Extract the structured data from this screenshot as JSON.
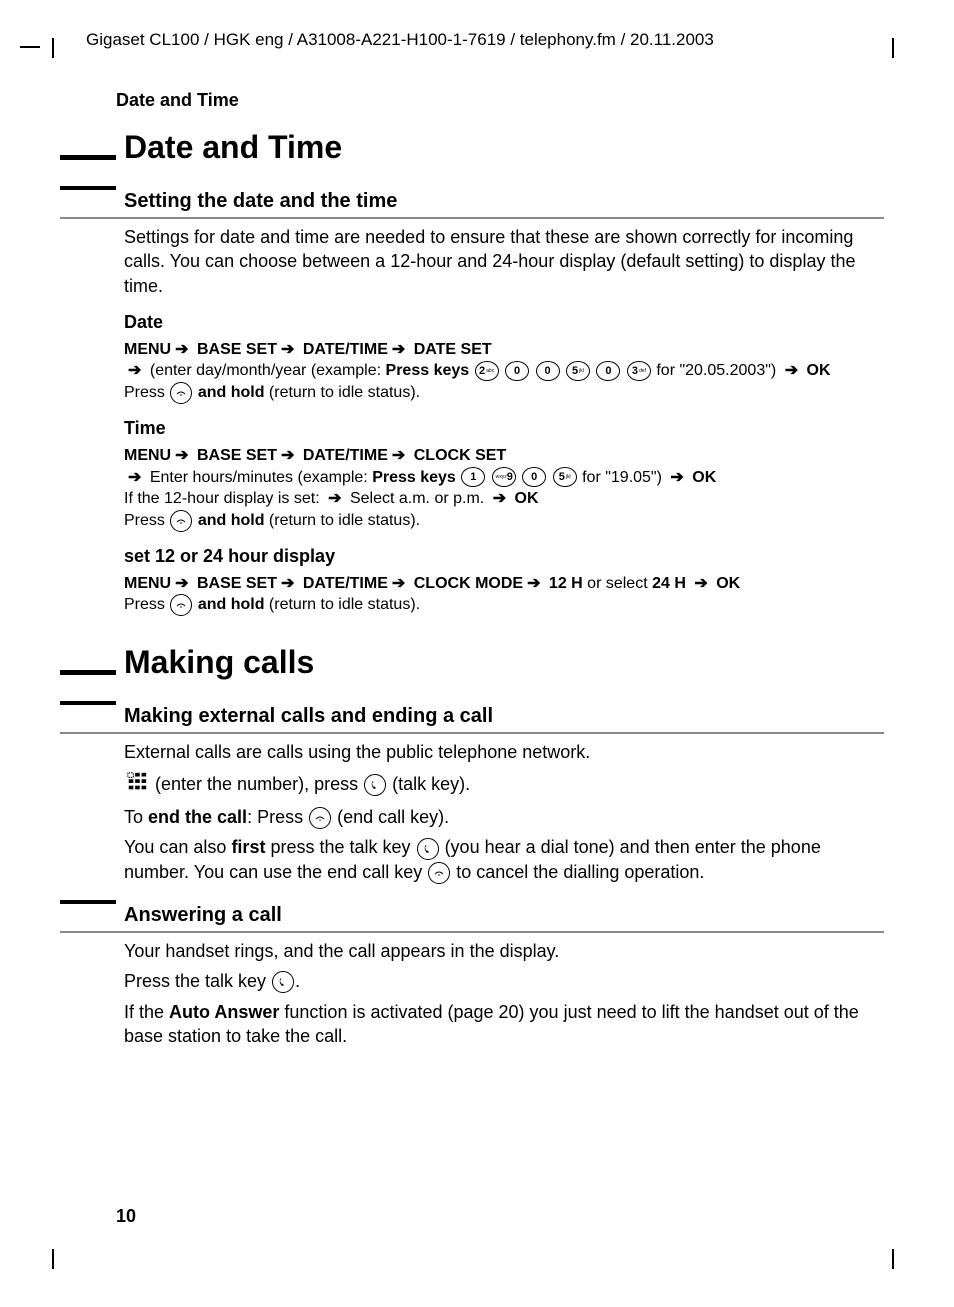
{
  "header_path": "Gigaset CL100 / HGK eng / A31008-A221-H100-1-7619 / telephony.fm / 20.11.2003",
  "running_head": "Date and Time",
  "page_number": "10",
  "sec1": {
    "title": "Date and Time",
    "sub1": {
      "title": "Setting the date and the time",
      "intro": "Settings for date and time are needed to ensure that these are shown correctly for incoming calls. You can choose between a 12-hour and 24-hour display (default setting) to display the time.",
      "date": {
        "title": "Date",
        "menu1": "MENU",
        "menu2": "BASE SET",
        "menu3": "DATE/TIME",
        "menu4": "DATE SET",
        "line2a": "(enter day/month/year (example:",
        "line2b": "Press keys",
        "line2c": "for \"20.05.2003\")",
        "ok": "OK",
        "press": "Press",
        "hold": "and hold",
        "idle": "(return to idle status)."
      },
      "time": {
        "title": "Time",
        "menu1": "MENU",
        "menu2": "BASE SET",
        "menu3": "DATE/TIME",
        "menu4": "CLOCK SET",
        "line2a": "Enter hours/minutes (example:",
        "line2b": "Press keys",
        "line2c": "for \"19.05\")",
        "ok": "OK",
        "line3a": "If the 12-hour display is set:",
        "line3b": "Select a.m. or p.m.",
        "press": "Press",
        "hold": "and hold",
        "idle": "(return to idle status)."
      },
      "mode": {
        "title": "set 12 or 24 hour display",
        "menu1": "MENU",
        "menu2": "BASE SET",
        "menu3": "DATE/TIME",
        "menu4": "CLOCK MODE",
        "opt1": "12 H",
        "or": "or select",
        "opt2": "24 H",
        "ok": "OK",
        "press": "Press",
        "hold": "and hold",
        "idle": "(return to idle status)."
      }
    }
  },
  "sec2": {
    "title": "Making calls",
    "sub1": {
      "title": "Making external calls and ending a call",
      "p1": "External calls are calls using the public telephone network.",
      "p2a": "(enter the number), press",
      "p2b": "(talk key).",
      "p3a": "To",
      "p3b": "end the call",
      "p3c": ": Press",
      "p3d": "(end call key).",
      "p4a": "You can also",
      "p4b": "first",
      "p4c": "press the talk key",
      "p4d": "(you hear a dial tone) and then enter the phone number. You can use the end call key",
      "p4e": "to cancel the dialling operation."
    },
    "sub2": {
      "title": "Answering a call",
      "p1": "Your handset rings, and the call appears in the display.",
      "p2a": "Press the talk key",
      "p2b": ".",
      "p3a": "If the",
      "p3b": "Auto Answer",
      "p3c": "function is activated (page 20) you just need to lift the handset out of the base station to take the call."
    }
  }
}
